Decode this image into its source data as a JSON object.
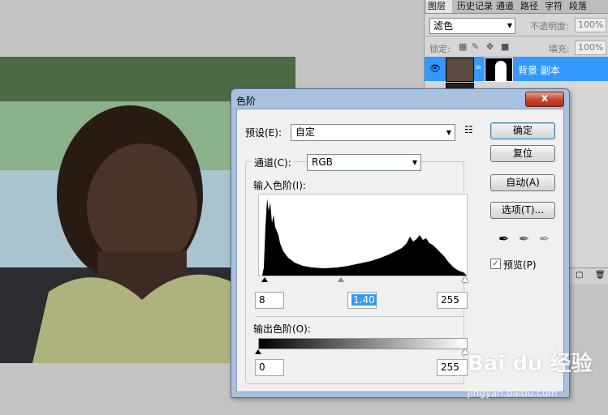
{
  "layers_panel": {
    "tabs": [
      "图层",
      "历史记录",
      "通道",
      "路径",
      "字符",
      "段落"
    ],
    "blend_mode": "滤色",
    "opacity_label": "不透明度:",
    "opacity_value": "100%",
    "lock_label": "锁定:",
    "fill_label": "填充:",
    "fill_value": "100%",
    "layers": [
      {
        "name": "背景 副本",
        "selected": true
      },
      {
        "name": "",
        "selected": false
      }
    ]
  },
  "levels_dialog": {
    "title": "色阶",
    "close_label": "x",
    "preset_label": "预设(E):",
    "preset_value": "自定",
    "channel_label": "通道(C):",
    "channel_value": "RGB",
    "input_levels_label": "输入色阶(I):",
    "input_black": "8",
    "input_gamma": "1.40",
    "input_white": "255",
    "output_levels_label": "输出色阶(O):",
    "output_black": "0",
    "output_white": "255",
    "buttons": {
      "ok": "确定",
      "reset": "复位",
      "auto": "自动(A)",
      "options": "选项(T)..."
    },
    "preview_label": "预览(P)",
    "preview_checked": true
  },
  "watermark": {
    "brand": "Bai du 经验",
    "url": "jingyan.baidu.com"
  },
  "colors": {
    "selection": "#3399ff",
    "dialog_frame": "#a9c1e0",
    "close_button": "#c4442c"
  }
}
